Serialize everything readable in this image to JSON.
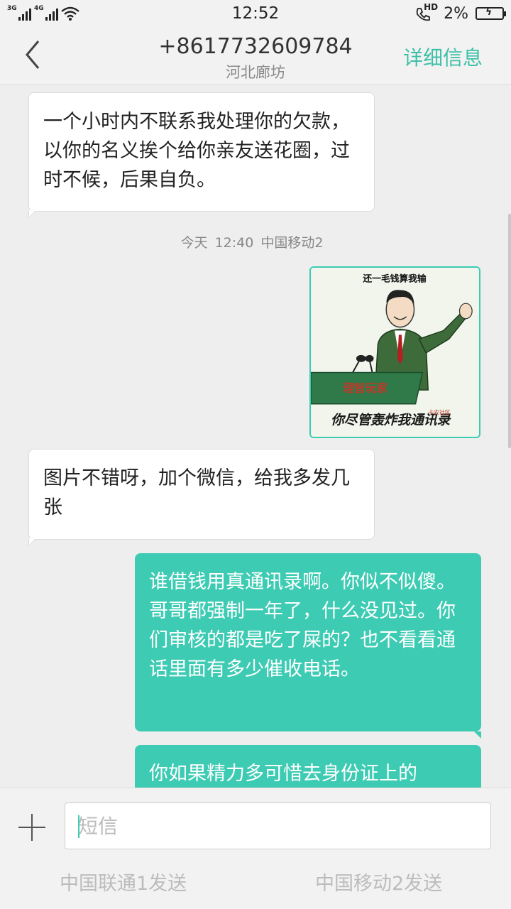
{
  "status_bar": {
    "net1": "3G",
    "net2": "4G",
    "time": "12:52",
    "hd": "HD",
    "battery": "2%"
  },
  "header": {
    "contact_number": "+8617732609784",
    "contact_location": "河北廊坊",
    "details_label": "详细信息"
  },
  "messages": [
    {
      "direction": "in",
      "text": "一个小时内不联系我处理你的欠款，以你的名义挨个给你亲友送花圈，过时不候，后果自负。"
    },
    {
      "type": "timestamp",
      "day": "今天",
      "time": "12:40",
      "carrier": "中国移动2"
    },
    {
      "direction": "out",
      "type": "image",
      "caption_top": "还一毛钱算我输",
      "podium_text": "理智玩家",
      "caption_bottom": "你尽管轰炸我通讯录",
      "watermark": "卡农社区"
    },
    {
      "direction": "in",
      "text": "图片不错呀，加个微信，给我多发几张"
    },
    {
      "direction": "out",
      "text": "谁借钱用真通讯录啊。你似不似傻。哥哥都强制一年了，什么没见过。你们审核的都是吃了屎的？也不看看通话里面有多少催收电话。"
    },
    {
      "direction": "out",
      "text": "你如果精力多可惜去身份证上的"
    }
  ],
  "composer": {
    "placeholder": "短信",
    "send_unicom": "中国联通1发送",
    "send_mobile": "中国移动2发送"
  },
  "colors": {
    "accent": "#3ecbb3",
    "link": "#3dc0a8"
  },
  "icons": [
    "back-arrow-icon",
    "plus-icon",
    "signal-icon",
    "wifi-icon",
    "hd-call-icon",
    "battery-icon"
  ]
}
